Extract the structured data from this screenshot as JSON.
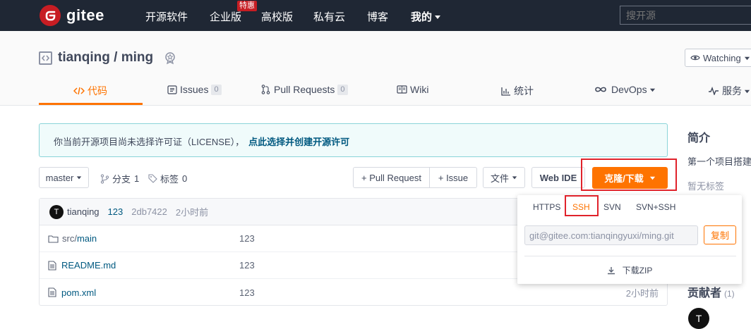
{
  "nav": {
    "logo_text": "gitee",
    "items": [
      "开源软件",
      "企业版",
      "高校版",
      "私有云",
      "博客",
      "我的"
    ],
    "badge": "特惠",
    "search_placeholder": "搜开源"
  },
  "repo": {
    "owner": "tianqing",
    "separator": " / ",
    "name": "ming",
    "watching_label": "Watching"
  },
  "tabs": [
    {
      "label": "代码"
    },
    {
      "label": "Issues",
      "count": "0"
    },
    {
      "label": "Pull Requests",
      "count": "0"
    },
    {
      "label": "Wiki"
    },
    {
      "label": "统计"
    },
    {
      "label": "DevOps"
    },
    {
      "label": "服务"
    }
  ],
  "license_notice": {
    "text": "你当前开源项目尚未选择许可证（LICENSE），",
    "link": "点此选择并创建开源许可"
  },
  "toolbar": {
    "branch": "master",
    "branches_label": "分支",
    "branches_count": "1",
    "tags_label": "标签",
    "tags_count": "0",
    "pull_request": "+ Pull Request",
    "issue": "+ Issue",
    "file_menu": "文件",
    "web_ide": "Web IDE",
    "clone": "克隆/下载"
  },
  "commit": {
    "avatar_letter": "T",
    "author": "tianqing",
    "message": "123",
    "hash": "2db7422",
    "time": "2小时前"
  },
  "files": [
    {
      "prefix": "src/",
      "name": "main",
      "message": "123",
      "time": ""
    },
    {
      "prefix": "",
      "name": "README.md",
      "message": "123",
      "time": ""
    },
    {
      "prefix": "",
      "name": "pom.xml",
      "message": "123",
      "time": "2小时前"
    }
  ],
  "clone_dropdown": {
    "protocols": [
      "HTTPS",
      "SSH",
      "SVN",
      "SVN+SSH"
    ],
    "url": "git@gitee.com:tianqingyuxi/ming.git",
    "copy": "复制",
    "download_zip": "下载ZIP"
  },
  "sidebar": {
    "intro_title": "简介",
    "intro_text": "第一个项目搭建",
    "tags_text": "暂无标签",
    "contributors_title": "贡献者",
    "contributors_count": "(1)",
    "contributor_letter": "T"
  },
  "colors": {
    "accent": "#fe7300",
    "nav_bg": "#1f2734",
    "brand_red": "#c71d23",
    "highlight": "#e0222b"
  }
}
